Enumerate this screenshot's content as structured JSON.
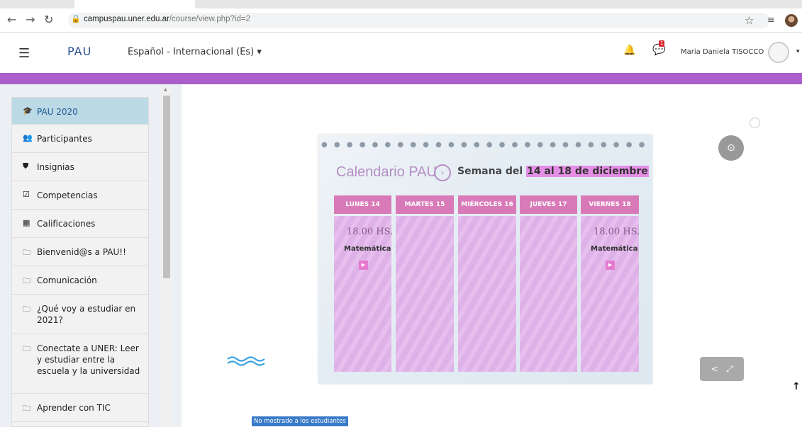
{
  "browser": {
    "url_domain": "campuspau.uner.edu.ar",
    "url_path": "/course/view.php?id=2"
  },
  "navbar": {
    "brand": "PAU",
    "language": "Español - Internacional (Es)",
    "notifications_badge": "1",
    "user_name": "Maria Daniela TISOCCO"
  },
  "sidebar": {
    "items": [
      {
        "icon": "graduation-cap-icon",
        "glyph": "🎓",
        "label": "PAU 2020",
        "active": true
      },
      {
        "icon": "users-icon",
        "glyph": "👥",
        "label": "Participantes"
      },
      {
        "icon": "shield-icon",
        "glyph": "⛊",
        "label": "Insignias"
      },
      {
        "icon": "checkbox-icon",
        "glyph": "☑",
        "label": "Competencias"
      },
      {
        "icon": "table-icon",
        "glyph": "▦",
        "label": "Calificaciones"
      },
      {
        "icon": "folder-icon",
        "glyph": "🗀",
        "label": "Bienvenid@s a PAU!!"
      },
      {
        "icon": "folder-icon",
        "glyph": "🗀",
        "label": "Comunicación"
      },
      {
        "icon": "folder-icon",
        "glyph": "🗀",
        "label": "¿Qué voy a estudiar en 2021?"
      },
      {
        "icon": "folder-icon",
        "glyph": "🗀",
        "label": "Conectate a UNER: Leer y estudiar entre la escuela y la universidad"
      },
      {
        "icon": "folder-icon",
        "glyph": "🗀",
        "label": "Aprender con TIC"
      }
    ]
  },
  "calendar": {
    "title": "Calendario PAU",
    "week_prefix": "Semana del",
    "week_range": "14 al 18 de diciembre",
    "days": [
      {
        "label": "LUNES 14",
        "time": "18.00 HS.",
        "subject": "Matemática"
      },
      {
        "label": "MARTES 15",
        "time": "",
        "subject": ""
      },
      {
        "label": "MIÉRCOLES 16",
        "time": "",
        "subject": ""
      },
      {
        "label": "JUEVES 17",
        "time": "",
        "subject": ""
      },
      {
        "label": "VIERNES 18",
        "time": "18.00 HS.",
        "subject": "Matemática"
      }
    ]
  },
  "note": {
    "hidden_label": "No mostrado a los estudiantes"
  },
  "colors": {
    "purple_bar": "#a95ec9",
    "day_header": "#d97ab8",
    "day_column": "#e2b6ec",
    "brand": "#2a4f8f"
  }
}
